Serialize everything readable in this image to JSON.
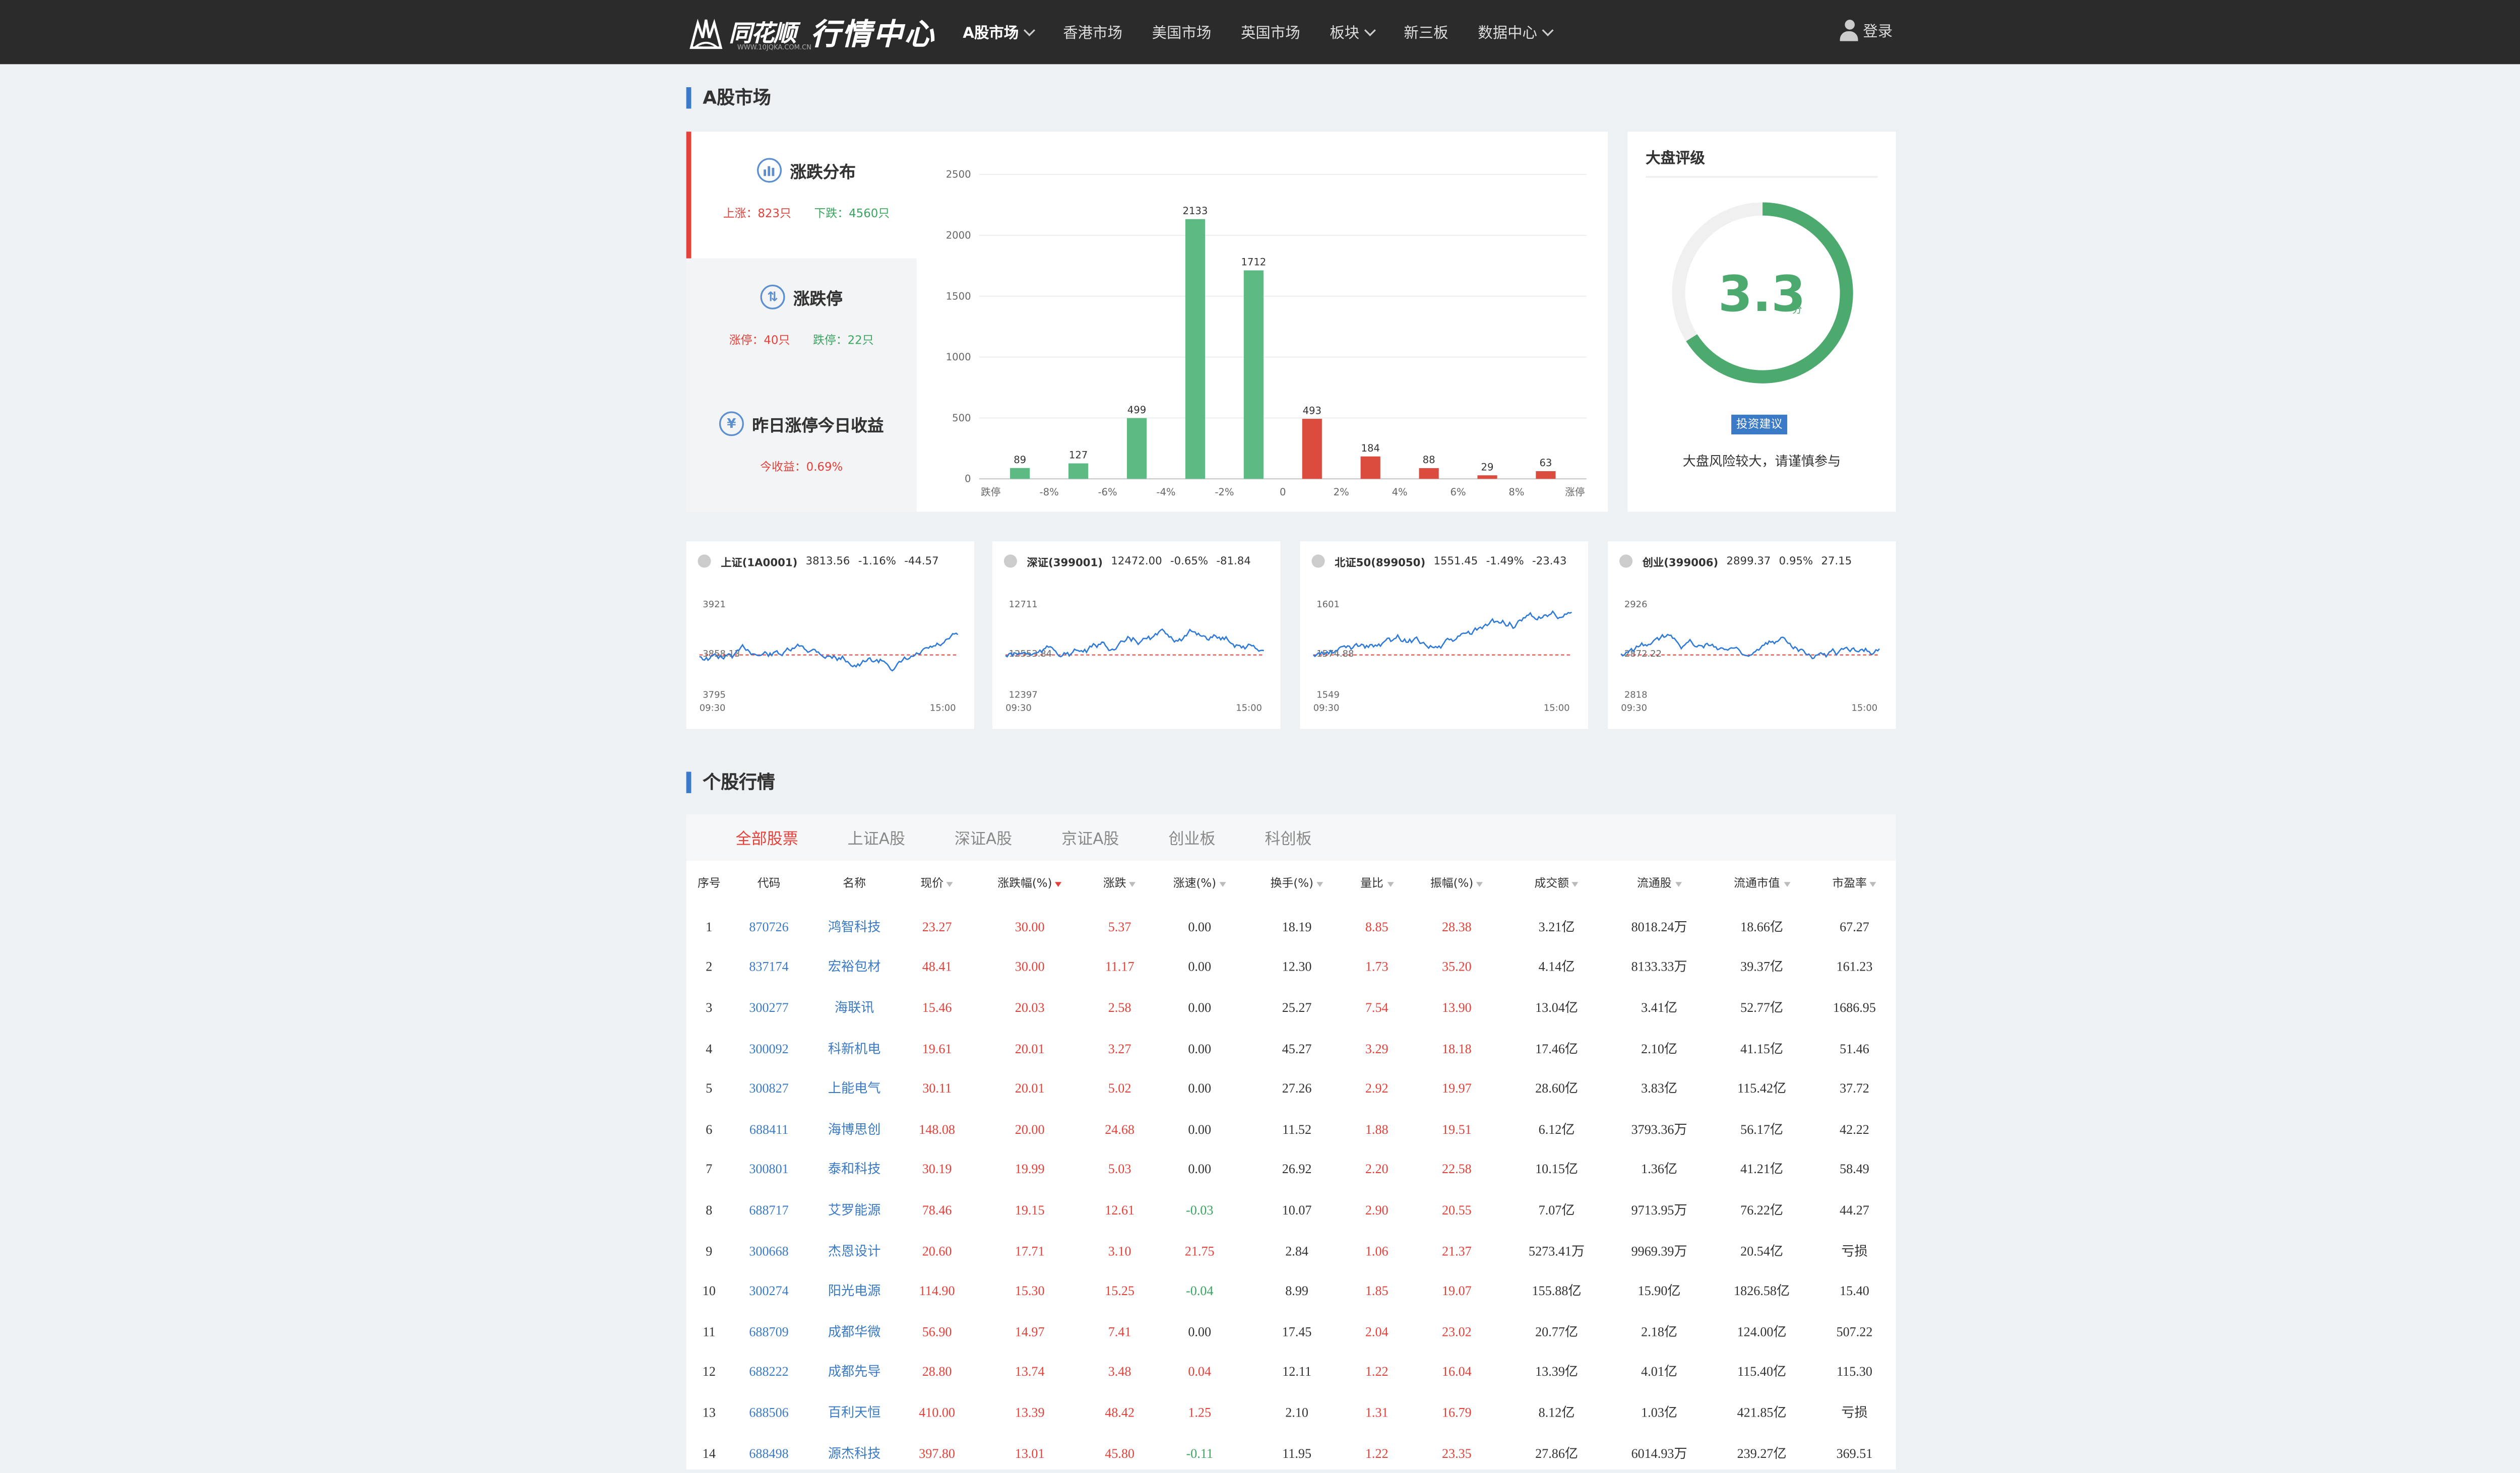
{
  "nav": {
    "brand": "同花顺",
    "brand_sub": "WWW.10JQKA.COM.CN",
    "title": "行情中心",
    "items": [
      {
        "label": "A股市场",
        "has_dropdown": true,
        "active": true
      },
      {
        "label": "香港市场",
        "has_dropdown": false
      },
      {
        "label": "美国市场",
        "has_dropdown": false
      },
      {
        "label": "英国市场",
        "has_dropdown": false
      },
      {
        "label": "板块",
        "has_dropdown": true
      },
      {
        "label": "新三板",
        "has_dropdown": false
      },
      {
        "label": "数据中心",
        "has_dropdown": true
      }
    ],
    "login": "登录"
  },
  "market": {
    "title": "A股市场",
    "left_items": [
      {
        "label": "涨跌分布",
        "icon": "bar-chart-icon",
        "stats": [
          "上涨：823只",
          "下跌：4560只"
        ]
      },
      {
        "label": "涨跌停",
        "icon": "updown-icon",
        "stats": [
          "涨停：40只",
          "跌停：22只"
        ]
      },
      {
        "label": "昨日涨停今日收益",
        "icon": "yen-icon",
        "stats": [
          "今收益：0.69%"
        ]
      }
    ]
  },
  "chart_data": {
    "type": "bar",
    "categories": [
      "跌停",
      "-8%",
      "-6%",
      "-4%",
      "-2%",
      "0",
      "2%",
      "4%",
      "6%",
      "8%",
      "涨停"
    ],
    "bar_values": [
      89,
      127,
      499,
      2133,
      1712,
      493,
      184,
      88,
      29,
      63
    ],
    "bar_colors": [
      "#5cba82",
      "#5cba82",
      "#5cba82",
      "#5cba82",
      "#5cba82",
      "#db4b3e",
      "#db4b3e",
      "#db4b3e",
      "#db4b3e",
      "#db4b3e"
    ],
    "ylim": [
      0,
      2500
    ],
    "yticks": [
      "0",
      "500",
      "1000",
      "1500",
      "2000",
      "2500"
    ],
    "grid": true
  },
  "rating": {
    "title": "大盘评级",
    "score": "3.3",
    "unit": "分",
    "score_fraction": 0.66,
    "tag": "投资建议",
    "desc": "大盘风险较大，请谨慎参与",
    "color": "#4daa6f"
  },
  "indices": [
    {
      "name": "上证(1A0001)",
      "price": "3813.56",
      "pct": "-1.16%",
      "chg": "-44.57",
      "y_high": "3921",
      "y_ref": "3858.13",
      "y_low": "3795",
      "t_start": "09:30",
      "t_end": "15:00"
    },
    {
      "name": "深证(399001)",
      "price": "12472.00",
      "pct": "-0.65%",
      "chg": "-81.84",
      "y_high": "12711",
      "y_ref": "12553.84",
      "y_low": "12397",
      "t_start": "09:30",
      "t_end": "15:00"
    },
    {
      "name": "北证50(899050)",
      "price": "1551.45",
      "pct": "-1.49%",
      "chg": "-23.43",
      "y_high": "1601",
      "y_ref": "1574.88",
      "y_low": "1549",
      "t_start": "09:30",
      "t_end": "15:00"
    },
    {
      "name": "创业(399006)",
      "price": "2899.37",
      "pct": "0.95%",
      "chg": "27.15",
      "y_high": "2926",
      "y_ref": "2872.22",
      "y_low": "2818",
      "t_start": "09:30",
      "t_end": "15:00"
    }
  ],
  "stocks": {
    "title": "个股行情",
    "tabs": [
      "全部股票",
      "上证A股",
      "深证A股",
      "京证A股",
      "创业板",
      "科创板"
    ],
    "active_tab": 0,
    "headers": [
      "序号",
      "代码",
      "名称",
      "现价",
      "涨跌幅(%)",
      "涨跌",
      "涨速(%)",
      "换手(%)",
      "量比",
      "振幅(%)",
      "成交额",
      "流通股",
      "流通市值",
      "市盈率"
    ],
    "sortable": [
      false,
      false,
      false,
      true,
      true,
      true,
      true,
      true,
      true,
      true,
      true,
      true,
      true,
      true
    ],
    "sorted_col": 4,
    "rows": [
      [
        "1",
        "870726",
        "鸿智科技",
        "23.27",
        "30.00",
        "5.37",
        "0.00",
        "18.19",
        "8.85",
        "28.38",
        "3.21亿",
        "8018.24万",
        "18.66亿",
        "67.27"
      ],
      [
        "2",
        "837174",
        "宏裕包材",
        "48.41",
        "30.00",
        "11.17",
        "0.00",
        "12.30",
        "1.73",
        "35.20",
        "4.14亿",
        "8133.33万",
        "39.37亿",
        "161.23"
      ],
      [
        "3",
        "300277",
        "海联讯",
        "15.46",
        "20.03",
        "2.58",
        "0.00",
        "25.27",
        "7.54",
        "13.90",
        "13.04亿",
        "3.41亿",
        "52.77亿",
        "1686.95"
      ],
      [
        "4",
        "300092",
        "科新机电",
        "19.61",
        "20.01",
        "3.27",
        "0.00",
        "45.27",
        "3.29",
        "18.18",
        "17.46亿",
        "2.10亿",
        "41.15亿",
        "51.46"
      ],
      [
        "5",
        "300827",
        "上能电气",
        "30.11",
        "20.01",
        "5.02",
        "0.00",
        "27.26",
        "2.92",
        "19.97",
        "28.60亿",
        "3.83亿",
        "115.42亿",
        "37.72"
      ],
      [
        "6",
        "688411",
        "海博思创",
        "148.08",
        "20.00",
        "24.68",
        "0.00",
        "11.52",
        "1.88",
        "19.51",
        "6.12亿",
        "3793.36万",
        "56.17亿",
        "42.22"
      ],
      [
        "7",
        "300801",
        "泰和科技",
        "30.19",
        "19.99",
        "5.03",
        "0.00",
        "26.92",
        "2.20",
        "22.58",
        "10.15亿",
        "1.36亿",
        "41.21亿",
        "58.49"
      ],
      [
        "8",
        "688717",
        "艾罗能源",
        "78.46",
        "19.15",
        "12.61",
        "-0.03",
        "10.07",
        "2.90",
        "20.55",
        "7.07亿",
        "9713.95万",
        "76.22亿",
        "44.27"
      ],
      [
        "9",
        "300668",
        "杰恩设计",
        "20.60",
        "17.71",
        "3.10",
        "21.75",
        "2.84",
        "1.06",
        "21.37",
        "5273.41万",
        "9969.39万",
        "20.54亿",
        "亏损"
      ],
      [
        "10",
        "300274",
        "阳光电源",
        "114.90",
        "15.30",
        "15.25",
        "-0.04",
        "8.99",
        "1.85",
        "19.07",
        "155.88亿",
        "15.90亿",
        "1826.58亿",
        "15.40"
      ],
      [
        "11",
        "688709",
        "成都华微",
        "56.90",
        "14.97",
        "7.41",
        "0.00",
        "17.45",
        "2.04",
        "23.02",
        "20.77亿",
        "2.18亿",
        "124.00亿",
        "507.22"
      ],
      [
        "12",
        "688222",
        "成都先导",
        "28.80",
        "13.74",
        "3.48",
        "0.04",
        "12.11",
        "1.22",
        "16.04",
        "13.39亿",
        "4.01亿",
        "115.40亿",
        "115.30"
      ],
      [
        "13",
        "688506",
        "百利天恒",
        "410.00",
        "13.39",
        "48.42",
        "1.25",
        "2.10",
        "1.31",
        "16.79",
        "8.12亿",
        "1.03亿",
        "421.85亿",
        "亏损"
      ],
      [
        "14",
        "688498",
        "源杰科技",
        "397.80",
        "13.01",
        "45.80",
        "-0.11",
        "11.95",
        "1.22",
        "23.35",
        "27.86亿",
        "6014.93万",
        "239.27亿",
        "369.51"
      ]
    ]
  }
}
